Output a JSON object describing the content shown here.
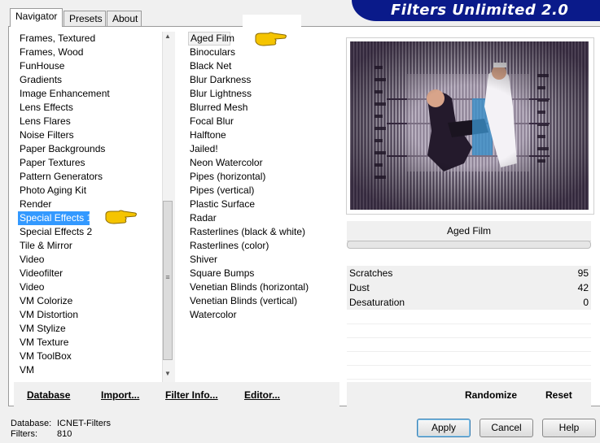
{
  "tabs": [
    "Navigator",
    "Presets",
    "About"
  ],
  "banner_title": "Filters Unlimited 2.0",
  "categories": [
    "Frames, Textured",
    "Frames, Wood",
    "FunHouse",
    "Gradients",
    "Image Enhancement",
    "Lens Effects",
    "Lens Flares",
    "Noise Filters",
    "Paper Backgrounds",
    "Paper Textures",
    "Pattern Generators",
    "Photo Aging Kit",
    "Render",
    "Special Effects 1",
    "Special Effects 2",
    "Tile & Mirror",
    "Video",
    "Videofilter",
    "Video",
    "VM Colorize",
    "VM Distortion",
    "VM Stylize",
    "VM Texture",
    "VM ToolBox",
    "VM"
  ],
  "selected_category": "Special Effects 1",
  "filters": [
    "Aged Film",
    "Binoculars",
    "Black Net",
    "Blur Darkness",
    "Blur Lightness",
    "Blurred Mesh",
    "Focal Blur",
    "Halftone",
    "Jailed!",
    "Neon Watercolor",
    "Pipes (horizontal)",
    "Pipes (vertical)",
    "Plastic Surface",
    "Radar",
    "Rasterlines (black & white)",
    "Rasterlines (color)",
    "Shiver",
    "Square Bumps",
    "Venetian Blinds (horizontal)",
    "Venetian Blinds (vertical)",
    "Watercolor"
  ],
  "selected_filter": "Aged Film",
  "parameters": {
    "filter_name": "Aged Film",
    "rows": [
      {
        "label": "Scratches",
        "value": "95"
      },
      {
        "label": "Dust",
        "value": "42"
      },
      {
        "label": "Desaturation",
        "value": "0"
      }
    ]
  },
  "links": {
    "database": "Database",
    "import": "Import...",
    "filter_info": "Filter Info...",
    "editor": "Editor...",
    "randomize": "Randomize",
    "reset": "Reset"
  },
  "info": {
    "database_label": "Database:",
    "database_value": "ICNET-Filters",
    "filters_label": "Filters:",
    "filters_value": "810"
  },
  "buttons": {
    "apply": "Apply",
    "cancel": "Cancel",
    "help": "Help"
  },
  "colors": {
    "banner": "#0a1a8a",
    "selection": "#3399ff",
    "hand": "#f5c400"
  },
  "icons": [
    "pointing-hand-icon",
    "scroll-up-icon",
    "scroll-down-icon",
    "scroll-grip-icon"
  ]
}
